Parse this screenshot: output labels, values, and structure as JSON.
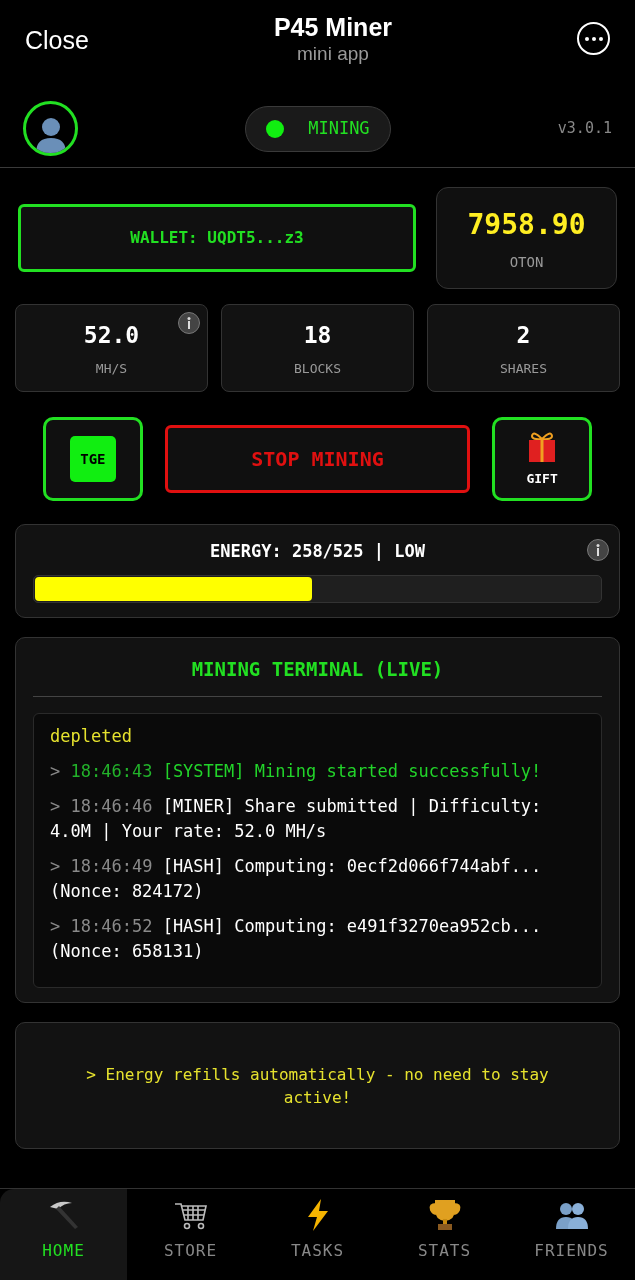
{
  "top_bar": {
    "close": "Close",
    "title": "P45 Miner",
    "subtitle": "mini app"
  },
  "status": {
    "mining_on": true,
    "label": "MINING",
    "version": "v3.0.1"
  },
  "wallet": {
    "label": "WALLET: UQDT5...z3"
  },
  "balance": {
    "amount": "7958.90",
    "unit": "OTON"
  },
  "stats": [
    {
      "value": "52.0",
      "label": "MH/S",
      "info": true
    },
    {
      "value": "18",
      "label": "BLOCKS",
      "info": false
    },
    {
      "value": "2",
      "label": "SHARES",
      "info": false
    }
  ],
  "actions": {
    "tge": "TGE",
    "stop": "STOP MINING",
    "gift": "GIFT"
  },
  "energy": {
    "label": "ENERGY: 258/525 | LOW",
    "level": 0.49
  },
  "terminal": {
    "title": "MINING TERMINAL (LIVE)",
    "entries": [
      {
        "kind": "warning",
        "text": "depleted"
      },
      {
        "kind": "success",
        "prompt": ">",
        "time": "18:46:43",
        "text": "[SYSTEM] Mining started successfully!"
      },
      {
        "kind": "info",
        "prompt": ">",
        "time": "18:46:46",
        "text": "[MINER] Share submitted | Difficulty: 4.0M | Your rate: 52.0 MH/s"
      },
      {
        "kind": "info",
        "prompt": ">",
        "time": "18:46:49",
        "text": "[HASH] Computing: 0ecf2d066f744abf... (Nonce: 824172)"
      },
      {
        "kind": "info",
        "prompt": ">",
        "time": "18:46:52",
        "text": "[HASH] Computing: e491f3270ea952cb... (Nonce: 658131)"
      }
    ]
  },
  "note": {
    "text": "> Energy refills automatically - no need to stay active!"
  },
  "nav": [
    {
      "kind": "pickaxe",
      "label": "HOME",
      "selected": true
    },
    {
      "kind": "cart",
      "label": "STORE",
      "selected": false
    },
    {
      "kind": "bolt",
      "label": "TASKS",
      "selected": false
    },
    {
      "kind": "trophy",
      "label": "STATS",
      "selected": false
    },
    {
      "kind": "people",
      "label": "FRIENDS",
      "selected": false
    }
  ]
}
